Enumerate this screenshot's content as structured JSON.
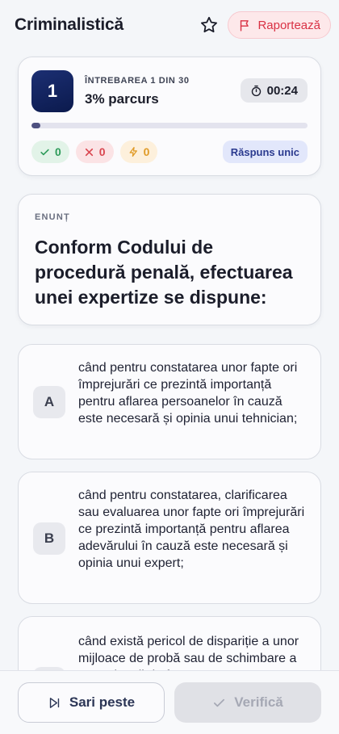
{
  "header": {
    "title": "Criminalistică",
    "favorite_icon": "star-icon",
    "report_label": "Raportează",
    "report_icon": "flag-icon"
  },
  "progress": {
    "question_number": "1",
    "question_label": "ÎNTREBAREA 1 DIN 30",
    "progress_text": "3% parcurs",
    "progress_fraction": 0.033,
    "timer_icon": "stopwatch-icon",
    "timer": "00:24",
    "correct_count": "0",
    "wrong_count": "0",
    "skipped_count": "0",
    "mode": "Răspuns unic"
  },
  "statement": {
    "label": "ENUNȚ",
    "text": "Conform Codului de procedură penală, efectuarea unei expertize se dispune:"
  },
  "answers": [
    {
      "letter": "A",
      "text": "când pentru constatarea unor fapte ori împrejurări ce prezintă importanță pentru aflarea persoanelor în cauză este necesară și opinia unui tehnician;"
    },
    {
      "letter": "B",
      "text": "când pentru constatarea, clarificarea sau evaluarea unor fapte ori împrejurări ce prezintă importanță pentru aflarea adevărului în cauză este necesară și opinia unui expert;"
    },
    {
      "letter": "C",
      "text": "când există pericol de dispariție a unor mijloace de probă sau de schimbare a unor situații de fapt"
    }
  ],
  "footer": {
    "skip_label": "Sari peste",
    "skip_icon": "skip-forward-icon",
    "verify_label": "Verifică",
    "verify_icon": "check-icon"
  },
  "colors": {
    "accent": "#0f1f5c",
    "correct": "#2e9b5a",
    "wrong": "#d9454f",
    "skipped": "#e09b28",
    "report": "#d93144"
  }
}
